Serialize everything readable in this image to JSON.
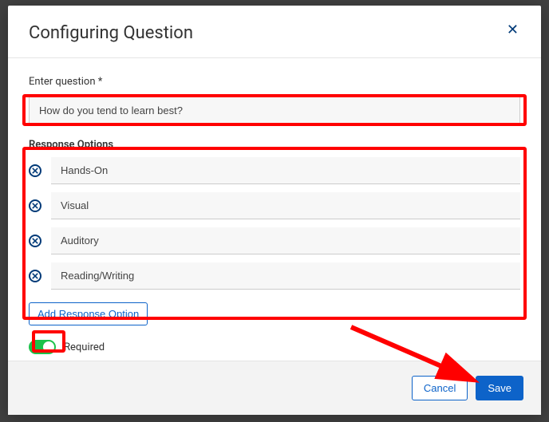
{
  "modal": {
    "title": "Configuring Question"
  },
  "form": {
    "question_label": "Enter question *",
    "question_value": "How do you tend to learn best?",
    "options_label": "Response Options",
    "options": [
      {
        "value": "Hands-On"
      },
      {
        "value": "Visual"
      },
      {
        "value": "Auditory"
      },
      {
        "value": "Reading/Writing"
      }
    ],
    "add_option_label": "Add Response Option",
    "required_label": "Required",
    "required_on": true
  },
  "footer": {
    "cancel": "Cancel",
    "save": "Save"
  }
}
